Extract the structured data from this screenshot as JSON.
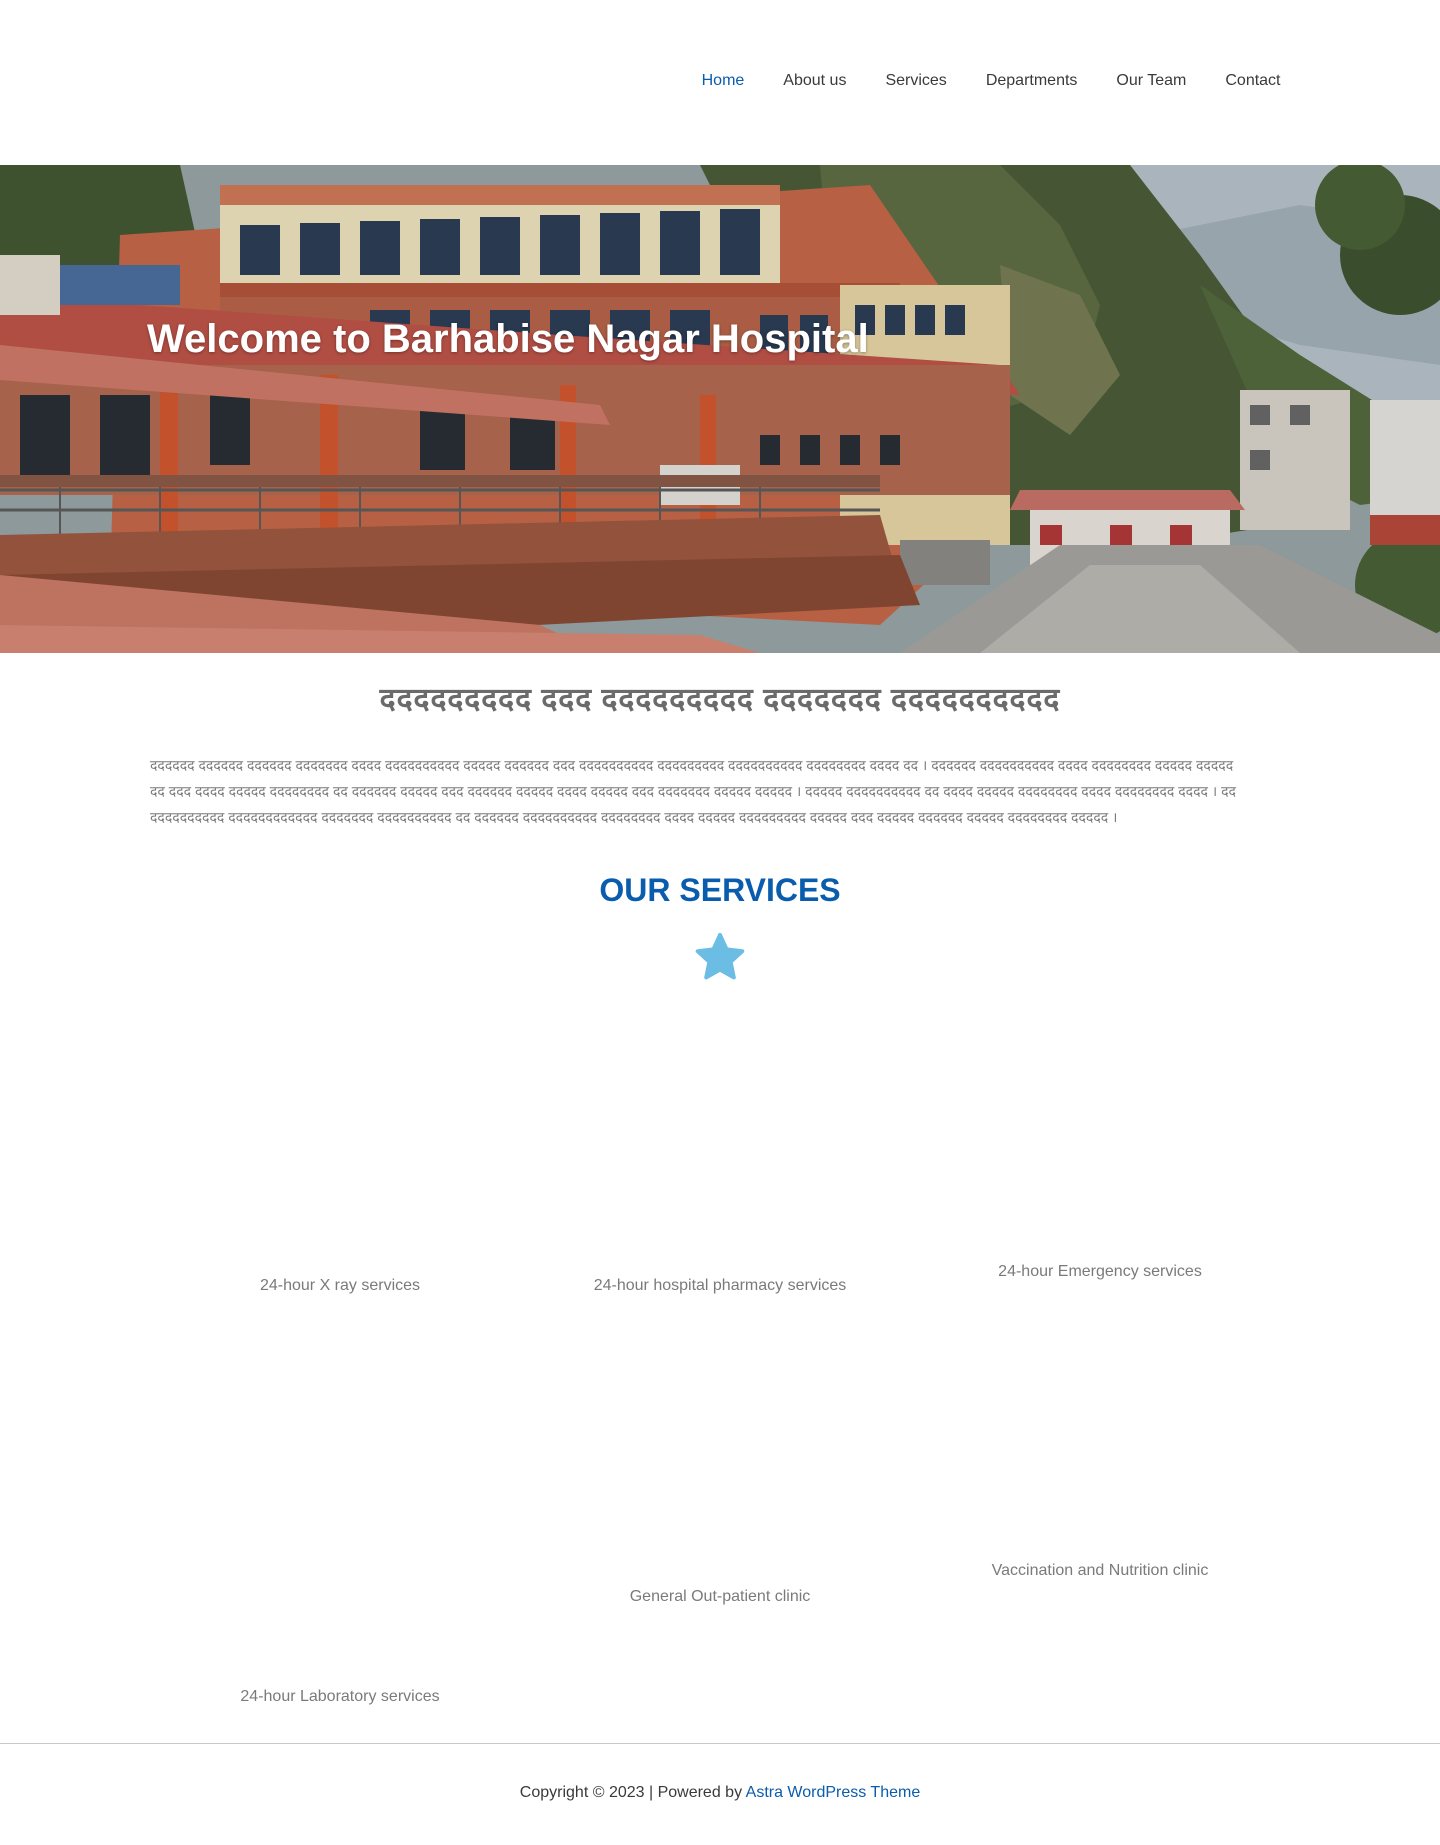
{
  "header": {
    "nav": [
      {
        "label": "Home",
        "active": true
      },
      {
        "label": "About us",
        "active": false
      },
      {
        "label": "Services",
        "active": false
      },
      {
        "label": "Departments",
        "active": false
      },
      {
        "label": "Our Team",
        "active": false
      },
      {
        "label": "Contact",
        "active": false
      }
    ]
  },
  "hero": {
    "title": "Welcome to Barhabise Nagar Hospital"
  },
  "intro": {
    "heading": "ददददददददद ददद ददददददददद ददददददद दददददददददद",
    "text": "दददददद दददददद दददददद ददददददद दददद दददददददददद ददददद दददददद ददद दददददददददद ददददददददद दददददददददद दददददददद दददद दद । दददददद दददददददददद दददद दददददददद ददददद ददददद दद ददद दददद ददददद दददददददद दद दददददद ददददद ददद दददददद ददददद दददद ददददद ददद ददददददद ददददद ददददद । ददददद दददददददददद दद दददद ददददद दददददददद दददद दददददददद दददद । दद दददददददददद दददददददददददद ददददददद दददददददददद दद दददददद दददददददददद दददददददद दददद ददददद ददददददददद ददददद ददद ददददद दददददद ददददद दददददददद ददददद ।"
  },
  "services": {
    "title": "OUR SERVICES",
    "items": [
      "24-hour X ray services",
      "24-hour hospital pharmacy services",
      "24-hour Emergency services",
      "24-hour Laboratory services",
      "General Out-patient clinic",
      "Vaccination and Nutrition clinic"
    ]
  },
  "footer": {
    "text": "Copyright © 2023 | Powered by ",
    "link": "Astra WordPress Theme"
  },
  "colors": {
    "accent": "#0a5cad",
    "star": "#6bbde3",
    "text": "#3a3a3a",
    "muted": "#7a7a7a"
  }
}
